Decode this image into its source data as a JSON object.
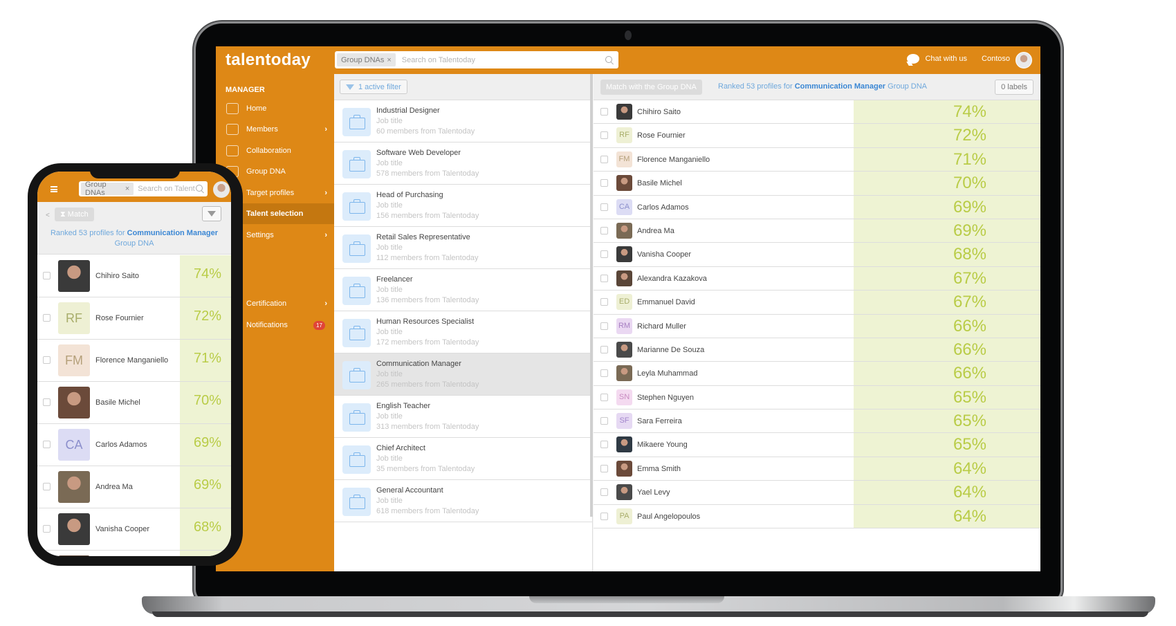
{
  "app": {
    "logo": "talentoday",
    "search_chip": "Group DNAs",
    "search_chip_close": "×",
    "search_placeholder": "Search on Talentoday",
    "chat_label": "Chat with us",
    "org_name": "Contoso"
  },
  "sidebar": {
    "section": "MANAGER",
    "items": [
      {
        "label": "Home",
        "icon": "home-icon",
        "chevron": ""
      },
      {
        "label": "Members",
        "icon": "members-icon",
        "chevron": "›"
      },
      {
        "label": "Collaboration",
        "icon": "handshake-icon",
        "chevron": ""
      },
      {
        "label": "Group DNA",
        "icon": "dna-icon",
        "chevron": ""
      },
      {
        "label": "Target profiles",
        "icon": "target-icon",
        "chevron": "›"
      },
      {
        "label": "Talent selection",
        "icon": "selection-icon",
        "chevron": "",
        "active": true
      },
      {
        "label": "Settings",
        "icon": "settings-icon",
        "chevron": "›"
      },
      {
        "label": "Certification",
        "icon": "certification-icon",
        "chevron": "›"
      },
      {
        "label": "Notifications",
        "icon": "bell-icon",
        "badge": "17"
      }
    ]
  },
  "jobs": {
    "filter_label": "1 active filter",
    "items": [
      {
        "title": "Industrial Designer",
        "type": "Job title",
        "members": "60 members from Talentoday"
      },
      {
        "title": "Software Web Developer",
        "type": "Job title",
        "members": "578 members from Talentoday"
      },
      {
        "title": "Head of Purchasing",
        "type": "Job title",
        "members": "156 members from Talentoday"
      },
      {
        "title": "Retail Sales Representative",
        "type": "Job title",
        "members": "112 members from Talentoday"
      },
      {
        "title": "Freelancer",
        "type": "Job title",
        "members": "136 members from Talentoday"
      },
      {
        "title": "Human Resources Specialist",
        "type": "Job title",
        "members": "172 members from Talentoday"
      },
      {
        "title": "Communication Manager",
        "type": "Job title",
        "members": "265 members from Talentoday",
        "selected": true
      },
      {
        "title": "English Teacher",
        "type": "Job title",
        "members": "313 members from Talentoday"
      },
      {
        "title": "Chief Architect",
        "type": "Job title",
        "members": "35 members from Talentoday"
      },
      {
        "title": "General Accountant",
        "type": "Job title",
        "members": "618 members from Talentoday"
      }
    ]
  },
  "ranking": {
    "match_button": "Match with the Group DNA",
    "ranked_prefix": "Ranked 53 profiles for",
    "ranked_target": "Communication Manager",
    "ranked_suffix": "Group DNA",
    "labels_button": "0 labels",
    "profiles": [
      {
        "name": "Chihiro Saito",
        "initials": "",
        "photo": true,
        "score": "74%"
      },
      {
        "name": "Rose Fournier",
        "initials": "RF",
        "bg": "#eef0d4",
        "fg": "#a8ad6a",
        "score": "72%"
      },
      {
        "name": "Florence Manganiello",
        "initials": "FM",
        "bg": "#f3e3d6",
        "fg": "#b5a07a",
        "score": "71%"
      },
      {
        "name": "Basile Michel",
        "initials": "",
        "photo": true,
        "score": "70%"
      },
      {
        "name": "Carlos Adamos",
        "initials": "CA",
        "bg": "#dcdcf4",
        "fg": "#8c8fcc",
        "score": "69%"
      },
      {
        "name": "Andrea Ma",
        "initials": "",
        "photo": true,
        "score": "69%"
      },
      {
        "name": "Vanisha Cooper",
        "initials": "",
        "photo": true,
        "score": "68%"
      },
      {
        "name": "Alexandra Kazakova",
        "initials": "",
        "photo": true,
        "score": "67%"
      },
      {
        "name": "Emmanuel David",
        "initials": "ED",
        "bg": "#eef0d4",
        "fg": "#a8ad6a",
        "score": "67%"
      },
      {
        "name": "Richard Muller",
        "initials": "RM",
        "bg": "#ead8f2",
        "fg": "#a77fc2",
        "score": "66%"
      },
      {
        "name": "Marianne De Souza",
        "initials": "",
        "photo": true,
        "score": "66%"
      },
      {
        "name": "Leyla Muhammad",
        "initials": "",
        "photo": true,
        "score": "66%"
      },
      {
        "name": "Stephen Nguyen",
        "initials": "SN",
        "bg": "#f4daf0",
        "fg": "#c88ac0",
        "score": "65%"
      },
      {
        "name": "Sara Ferreira",
        "initials": "SF",
        "bg": "#e6d9f3",
        "fg": "#a285cc",
        "score": "65%"
      },
      {
        "name": "Mikaere Young",
        "initials": "",
        "photo": true,
        "score": "65%"
      },
      {
        "name": "Emma Smith",
        "initials": "",
        "photo": true,
        "score": "64%"
      },
      {
        "name": "Yael Levy",
        "initials": "",
        "photo": true,
        "score": "64%"
      },
      {
        "name": "Paul Angelopoulos",
        "initials": "PA",
        "bg": "#eef0d4",
        "fg": "#a8ad6a",
        "score": "64%"
      }
    ]
  },
  "phone": {
    "search_placeholder": "Search on Talent",
    "back_label": "<",
    "match_button": "Match",
    "ranked_prefix": "Ranked 53 profiles for",
    "ranked_target": "Communication Manager",
    "ranked_suffix": "Group DNA"
  },
  "colors": {
    "brand_orange": "#de8816",
    "active_sidebar": "#c47710",
    "link_blue": "#3b87d4",
    "score_green": "#b9cc47",
    "score_bg": "#eef3d3",
    "badge_red": "#e04438"
  }
}
